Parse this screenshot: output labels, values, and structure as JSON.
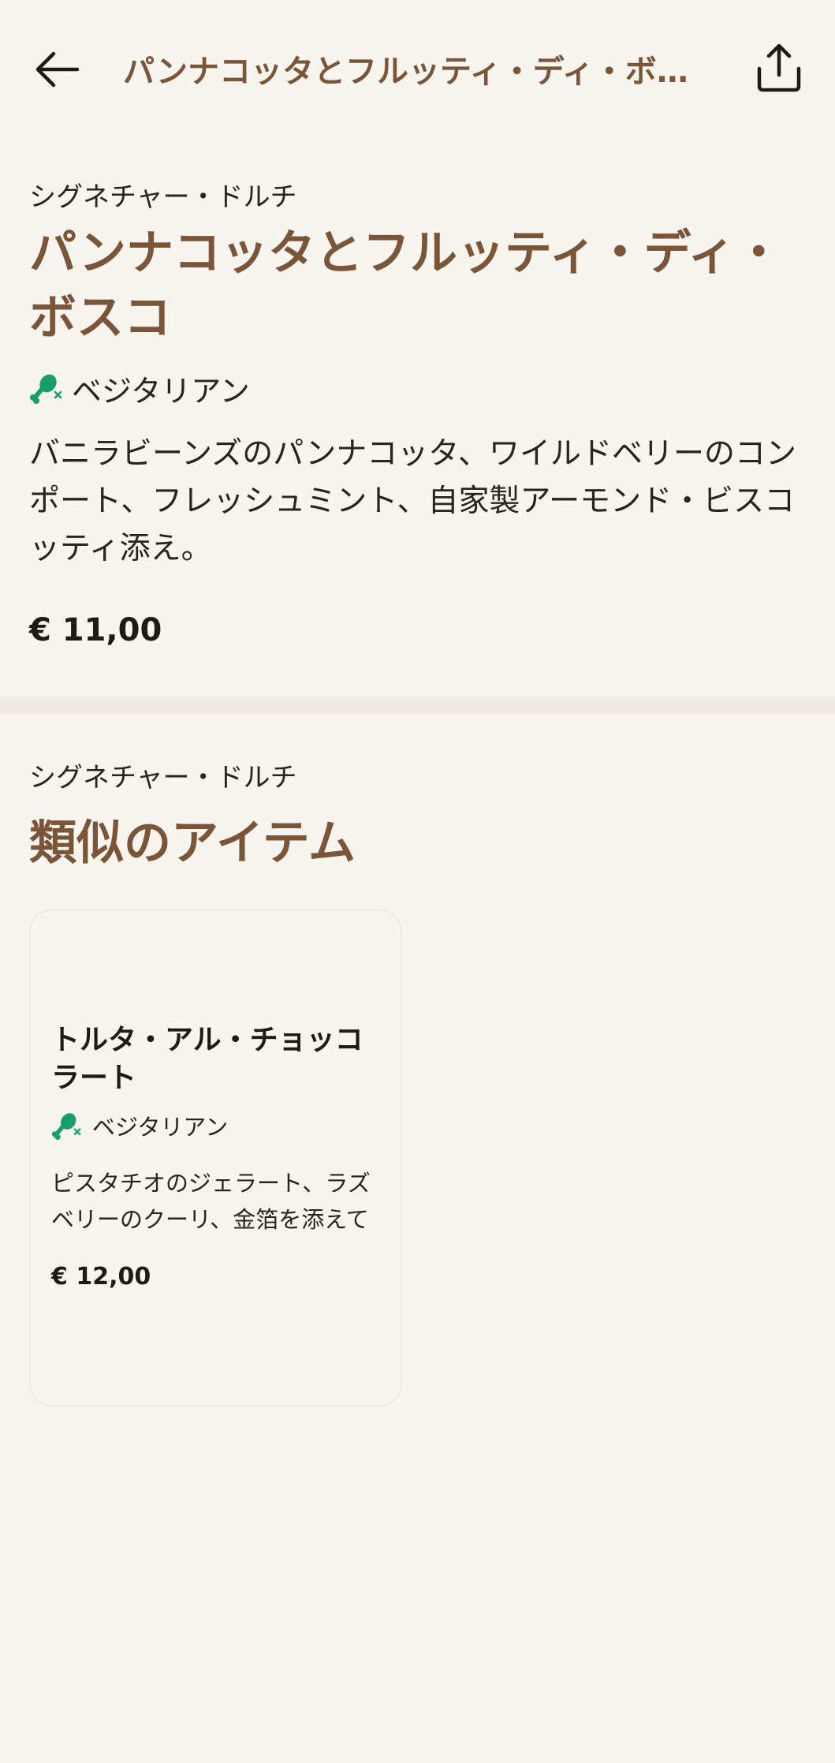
{
  "header": {
    "title": "パンナコッタとフルッティ・ディ・ボスコ",
    "back_icon": "arrow-left-icon",
    "share_icon": "share-icon"
  },
  "item": {
    "category": "シグネチャー・ドルチ",
    "title": "パンナコッタとフルッティ・ディ・ボスコ",
    "diet_label": "ベジタリアン",
    "diet_icon": "vegetarian-no-meat-icon",
    "description": "バニラビーンズのパンナコッタ、ワイルドベリーのコンポート、フレッシュミント、自家製アーモンド・ビスコッティ添え。",
    "price": "€ 11,00"
  },
  "similar": {
    "category": "シグネチャー・ドルチ",
    "title": "類似のアイテム",
    "cards": [
      {
        "title": "トルタ・アル・チョッコラート",
        "diet_label": "ベジタリアン",
        "description": "ピスタチオのジェラート、ラズベリーのクーリ、金箔を添えて",
        "price": "€ 12,00"
      }
    ]
  },
  "colors": {
    "background": "#f8f4ef",
    "accent_brown": "#7a5538",
    "vegetarian_green": "#1a9e68",
    "text": "#1f1a14"
  }
}
